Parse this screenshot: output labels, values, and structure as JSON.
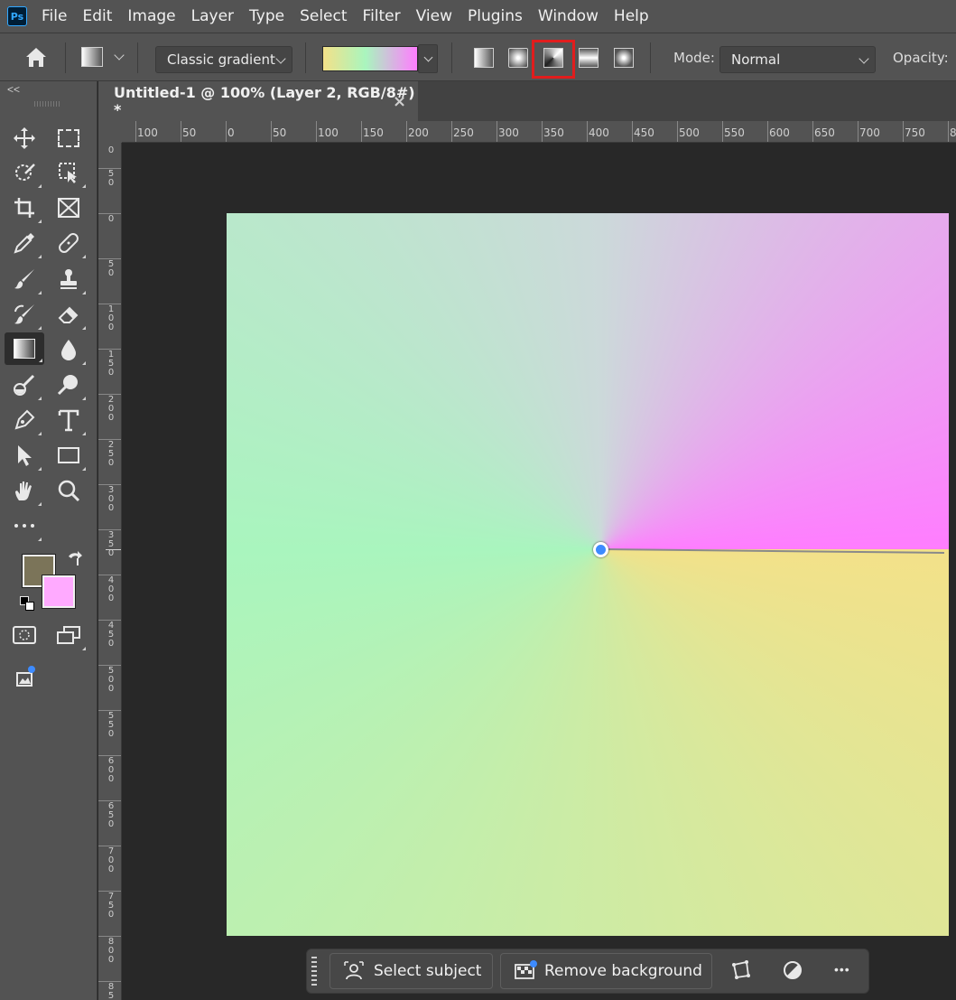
{
  "app": {
    "logo": "Ps"
  },
  "menu": [
    "File",
    "Edit",
    "Image",
    "Layer",
    "Type",
    "Select",
    "Filter",
    "View",
    "Plugins",
    "Window",
    "Help"
  ],
  "options": {
    "gradient_style": "Classic gradient",
    "mode_label": "Mode:",
    "mode_value": "Normal",
    "opacity_label": "Opacity:",
    "gradient_types": [
      "linear",
      "radial",
      "angle",
      "reflected",
      "diamond"
    ],
    "selected_gradient_type": "angle",
    "gradient_colors": [
      "#f3e189",
      "#a9f5be",
      "#ff7dff"
    ]
  },
  "document": {
    "tab_title": "Untitled-1 @ 100% (Layer 2, RGB/8#) *",
    "close_glyph": "×"
  },
  "rulers": {
    "top_labels": [
      "100",
      "50",
      "0",
      "50",
      "100",
      "150",
      "200",
      "250",
      "300",
      "350",
      "400",
      "450",
      "500",
      "550",
      "600",
      "650",
      "700",
      "750",
      "8"
    ],
    "left_labels": [
      "0",
      "50",
      "0",
      "50",
      "100",
      "150",
      "200",
      "250",
      "300",
      "350",
      "400",
      "450",
      "500",
      "550",
      "600",
      "650",
      "700",
      "750",
      "800",
      "85"
    ]
  },
  "toolbar": {
    "collapse_glyph": "<<",
    "foreground_color": "#7b7459",
    "background_color": "#ffaaff"
  },
  "taskbar": {
    "select_subject": "Select subject",
    "remove_background": "Remove background",
    "more_glyph": "•••"
  }
}
